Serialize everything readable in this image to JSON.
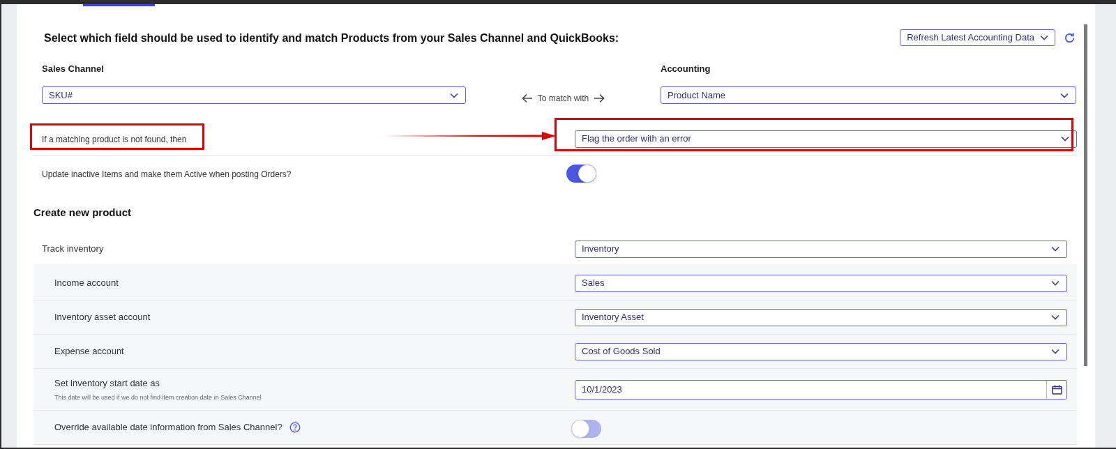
{
  "heading": "Select which field should be used to identify and match Products from your Sales Channel and QuickBooks:",
  "refresh": {
    "label": "Refresh Latest Accounting Data"
  },
  "match": {
    "left_label": "Sales Channel",
    "left_value": "SKU#",
    "middle": "To match with",
    "right_label": "Accounting",
    "right_value": "Product Name"
  },
  "settings": [
    {
      "kind": "select",
      "label": "If a matching product is not found, then",
      "value": "Flag the order with an error",
      "highlighted": true
    },
    {
      "kind": "toggle",
      "label": "Update inactive Items and make them Active when posting Orders?",
      "on": true
    }
  ],
  "section_title": "Create new product",
  "product_rows": [
    {
      "kind": "select",
      "label": "Track inventory",
      "value": "Inventory",
      "children": [
        {
          "kind": "select",
          "label": "Income account",
          "value": "Sales"
        },
        {
          "kind": "select",
          "label": "Inventory asset account",
          "value": "Inventory Asset"
        },
        {
          "kind": "select",
          "label": "Expense account",
          "value": "Cost of Goods Sold"
        },
        {
          "kind": "date",
          "label": "Set inventory start date as",
          "hint": "This date will be used if we do not find item creation date in Sales Channel",
          "value": "10/1/2023"
        },
        {
          "kind": "toggle",
          "label": "Override available date information from Sales Channel?",
          "help": true,
          "on": false
        }
      ]
    }
  ]
}
